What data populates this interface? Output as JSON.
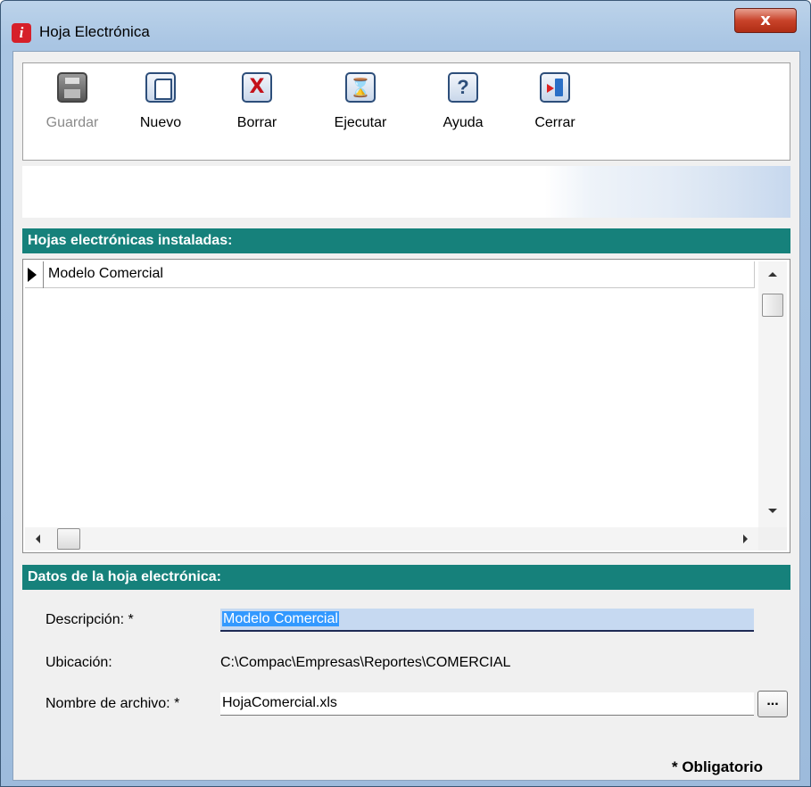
{
  "window": {
    "title": "Hoja Electrónica",
    "close_label": "x",
    "app_icon_glyph": "i"
  },
  "toolbar": {
    "buttons": [
      {
        "name": "guardar",
        "label": "Guardar",
        "icon": "save-icon",
        "enabled": false
      },
      {
        "name": "nuevo",
        "label": "Nuevo",
        "icon": "new-document-icon",
        "enabled": true
      },
      {
        "name": "borrar",
        "label": "Borrar",
        "icon": "delete-icon",
        "enabled": true
      },
      {
        "name": "ejecutar",
        "label": "Ejecutar",
        "icon": "hourglass-icon",
        "enabled": true
      },
      {
        "name": "ayuda",
        "label": "Ayuda",
        "icon": "help-icon",
        "enabled": true
      },
      {
        "name": "cerrar",
        "label": "Cerrar",
        "icon": "exit-door-icon",
        "enabled": true
      }
    ]
  },
  "installed": {
    "header": "Hojas electrónicas instaladas:",
    "rows": [
      "Modelo Comercial"
    ]
  },
  "details": {
    "header": "Datos de la hoja electrónica:",
    "descripcion_label": "Descripción: *",
    "descripcion_value": "Modelo Comercial",
    "ubicacion_label": "Ubicación:",
    "ubicacion_value": "C:\\Compac\\Empresas\\Reportes\\COMERCIAL",
    "archivo_label": "Nombre de archivo: *",
    "archivo_value": "HojaComercial.xls",
    "browse_label": "..."
  },
  "required_note": "* Obligatorio",
  "colors": {
    "section_header": "#16817b",
    "selection": "#3399ff",
    "close_button": "#c8432a"
  }
}
